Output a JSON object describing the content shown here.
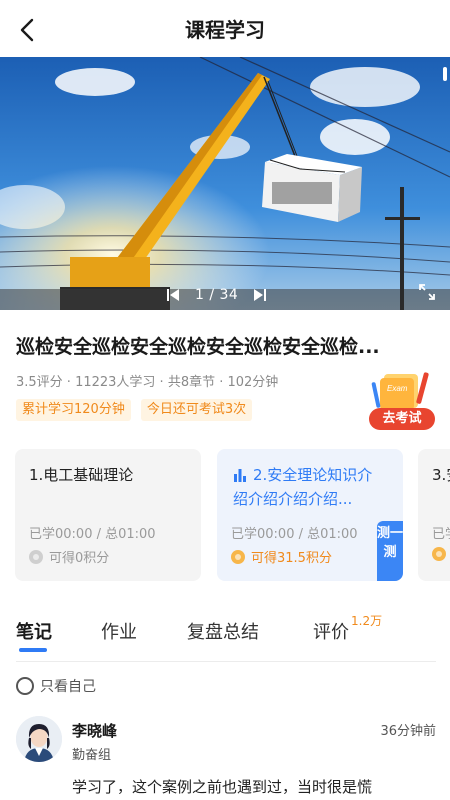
{
  "header": {
    "title": "课程学习"
  },
  "player": {
    "page_indicator": "1 / 34"
  },
  "course": {
    "title": "巡检安全巡检安全巡检安全巡检安全巡检...",
    "meta": "3.5评分 · 11223人学习 · 共8章节 · 102分钟",
    "tags": [
      "累计学习120分钟",
      "今日还可考试3次"
    ],
    "exam_button": {
      "badge": "Exam",
      "label": "去考试"
    }
  },
  "chapters": [
    {
      "title": "1.电工基础理论",
      "progress": "已学00:00 / 总01:00",
      "points": "可得0积分",
      "active": false
    },
    {
      "title": "2.安全理论知识介绍介绍介绍介绍...",
      "progress": "已学00:00 / 总01:00",
      "points": "可得31.5积分",
      "active": true,
      "test_label": "测一测"
    },
    {
      "title": "3.安",
      "progress": "已学",
      "points": "",
      "active": false
    }
  ],
  "tabs": [
    {
      "label": "笔记",
      "active": true
    },
    {
      "label": "作业",
      "active": false
    },
    {
      "label": "复盘总结",
      "active": false
    },
    {
      "label": "评价",
      "active": false,
      "badge": "1.2万"
    }
  ],
  "filter": {
    "only_self_label": "只看自己"
  },
  "comments": [
    {
      "name": "李晓峰",
      "group": "勤奋组",
      "time": "36分钟前",
      "text": "学习了，这个案例之前也遇到过，当时很是慌"
    }
  ],
  "colors": {
    "accent": "#2f7bf5",
    "orange": "#f08a1c",
    "red": "#e8452f"
  }
}
